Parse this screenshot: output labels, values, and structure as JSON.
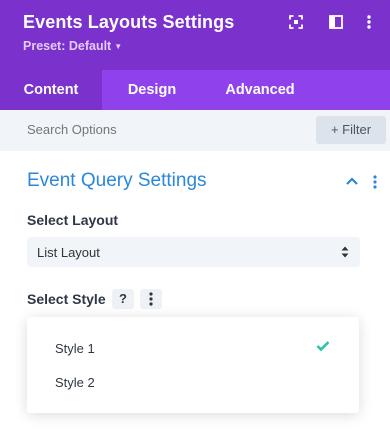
{
  "header": {
    "title": "Events Layouts Settings",
    "preset_label": "Preset: Default",
    "accent_color": "#7b32cc",
    "icons": [
      "focus-icon",
      "sidebar-layout-icon",
      "more-icon"
    ]
  },
  "tabs": [
    {
      "label": "Content",
      "active": true
    },
    {
      "label": "Design",
      "active": false
    },
    {
      "label": "Advanced",
      "active": false
    }
  ],
  "search": {
    "placeholder": "Search Options",
    "filter_label": "+ Filter"
  },
  "section": {
    "title": "Event Query Settings",
    "title_color": "#2b87da"
  },
  "fields": {
    "layout": {
      "label": "Select Layout",
      "value": "List Layout"
    },
    "style": {
      "label": "Select Style",
      "help_label": "?",
      "options": [
        {
          "label": "Style 1",
          "selected": true
        },
        {
          "label": "Style 2",
          "selected": false
        }
      ],
      "check_color": "#29c4a9"
    }
  }
}
